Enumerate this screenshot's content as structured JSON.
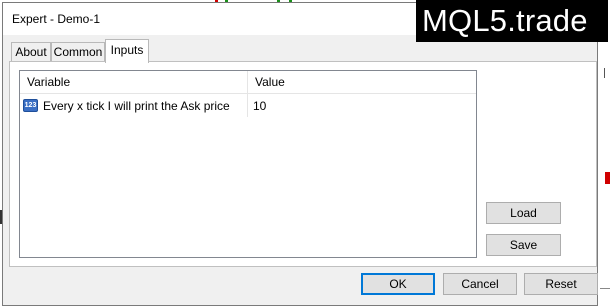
{
  "window": {
    "title": "Expert - Demo-1",
    "watermark": "MQL5.trade"
  },
  "tabs": [
    {
      "label": "About",
      "active": false
    },
    {
      "label": "Common",
      "active": false
    },
    {
      "label": "Inputs",
      "active": true
    }
  ],
  "inputs_table": {
    "columns": [
      "Variable",
      "Value"
    ],
    "rows": [
      {
        "type_icon": "integer-type-icon",
        "icon_text": "123",
        "variable": "Every x tick I will print the Ask price",
        "value": "10"
      }
    ]
  },
  "side_buttons": {
    "load_label": "Load",
    "save_label": "Save"
  },
  "footer_buttons": {
    "ok_label": "OK",
    "cancel_label": "Cancel",
    "reset_label": "Reset"
  },
  "colors": {
    "dialog_bg": "#f0f0f0",
    "focus_border": "#0078d7",
    "icon_blue": "#3a6fc4"
  }
}
